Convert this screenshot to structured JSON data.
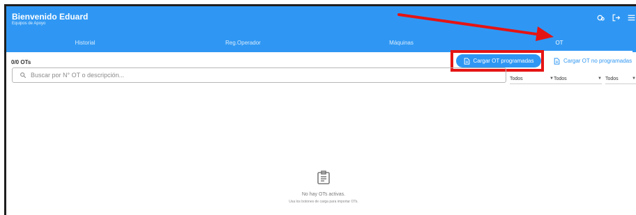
{
  "app": {
    "title": "Bienvenido Eduard",
    "subtitle": "Equipos de Apoyo"
  },
  "tabs": [
    {
      "label": "Historial",
      "active": false
    },
    {
      "label": "Reg.Operador",
      "active": false
    },
    {
      "label": "Máquinas",
      "active": false
    },
    {
      "label": "OT",
      "active": true
    }
  ],
  "header_icons": [
    "settings-icon",
    "logout-icon",
    "menu-icon"
  ],
  "toolbar": {
    "count": "0/0 OTs",
    "load_programmed": "Cargar OT programadas",
    "load_unprogrammed": "Cargar OT no programadas"
  },
  "search": {
    "placeholder": "Buscar por N° OT o descripción..."
  },
  "filters": [
    {
      "value": "Todos"
    },
    {
      "value": "Todos"
    },
    {
      "value": "Todos"
    }
  ],
  "empty_state": {
    "title": "No hay OTs activas.",
    "subtitle": "Usa los botones de carga para importar OTs."
  },
  "colors": {
    "primary": "#2f97f3",
    "annotation": "#e51414"
  }
}
